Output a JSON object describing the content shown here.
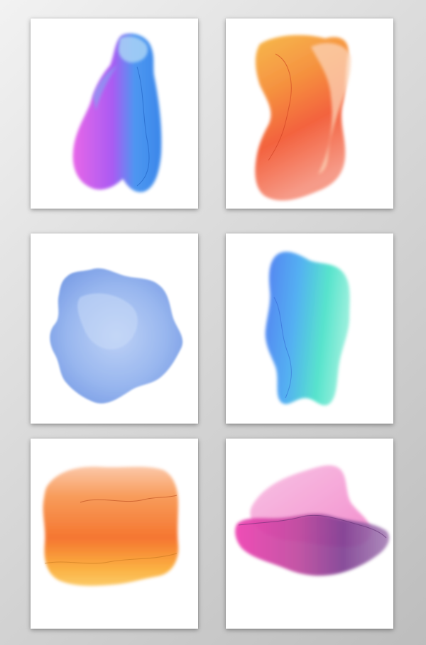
{
  "cards": [
    {
      "id": "purple-blue-splash",
      "colors": [
        "#b14cf0",
        "#e056e6",
        "#3f8ff0",
        "#9fd2f5"
      ]
    },
    {
      "id": "orange-red-splash",
      "colors": [
        "#f5a233",
        "#f35a28",
        "#f7896b",
        "#fbd2b8"
      ]
    },
    {
      "id": "blue-splash",
      "colors": [
        "#7fa6ec",
        "#a7c2f2",
        "#5c86df"
      ]
    },
    {
      "id": "blue-teal-splash",
      "colors": [
        "#3a6ff0",
        "#3ec6f4",
        "#35e3c4",
        "#8fbff7"
      ]
    },
    {
      "id": "orange-yellow-splash",
      "colors": [
        "#f57a2a",
        "#fbae3c",
        "#fbc7a6",
        "#f59b2d"
      ]
    },
    {
      "id": "pink-purple-splash",
      "colors": [
        "#e63fb0",
        "#8d4aa0",
        "#f49ad4",
        "#6a3b8c"
      ]
    }
  ]
}
